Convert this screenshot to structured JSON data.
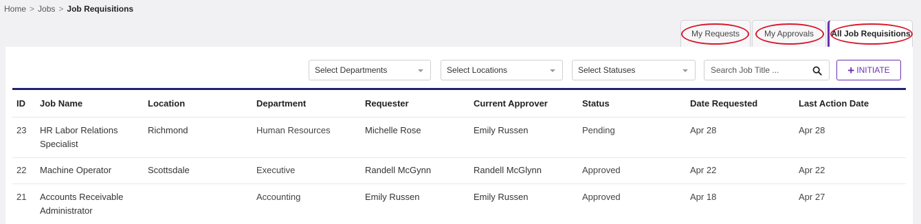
{
  "breadcrumb": {
    "home": "Home",
    "separator": ">",
    "jobs": "Jobs",
    "current": "Job Requisitions"
  },
  "tabs": {
    "my_requests": "My Requests",
    "my_approvals": "My Approvals",
    "all_job_requisitions": "All Job Requisitions"
  },
  "filters": {
    "departments": "Select Departments",
    "locations": "Select Locations",
    "statuses": "Select Statuses",
    "search_placeholder": "Search Job Title ...",
    "initiate_plus": "+",
    "initiate_label": "INITIATE"
  },
  "table": {
    "headers": {
      "id": "ID",
      "job_name": "Job Name",
      "location": "Location",
      "department": "Department",
      "requester": "Requester",
      "current_approver": "Current Approver",
      "status": "Status",
      "date_requested": "Date Requested",
      "last_action_date": "Last Action Date"
    },
    "rows": [
      {
        "id": "23",
        "job_name": "HR Labor Relations Specialist",
        "location": "Richmond",
        "department": "Human Resources",
        "requester": "Michelle Rose",
        "current_approver": "Emily Russen",
        "status": "Pending",
        "date_requested": "Apr 28",
        "last_action_date": "Apr 28"
      },
      {
        "id": "22",
        "job_name": "Machine Operator",
        "location": "Scottsdale",
        "department": "Executive",
        "requester": "Randell McGynn",
        "current_approver": "Randell McGlynn",
        "status": "Approved",
        "date_requested": "Apr 22",
        "last_action_date": "Apr 22"
      },
      {
        "id": "21",
        "job_name": "Accounts Receivable Administrator",
        "location": "",
        "department": "Accounting",
        "requester": "Emily Russen",
        "current_approver": "Emily Russen",
        "status": "Approved",
        "date_requested": "Apr 18",
        "last_action_date": "Apr 27"
      }
    ]
  },
  "colors": {
    "accent": "#6a2fb0",
    "header_rule": "#1e2370",
    "annotation": "#d9182a",
    "background": "#f1f1f4"
  },
  "icons": {
    "search": "search-icon",
    "caret": "chevron-down-icon"
  }
}
